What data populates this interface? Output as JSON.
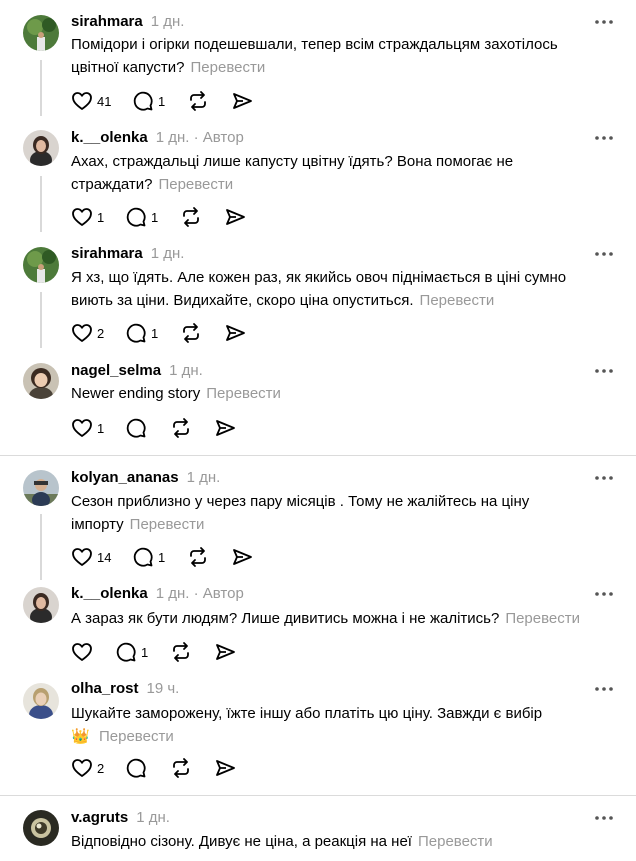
{
  "translate_label": "Перевести",
  "posts": [
    {
      "username": "sirahmara",
      "time": "1 дн.",
      "author": "",
      "text": "Помідори і огірки подешевшали, тепер всім страждальцям захотілось цвітної капусти?",
      "likes": "41",
      "replies": "1"
    },
    {
      "username": "k.__olenka",
      "time": "1 дн.",
      "author": "· Автор",
      "text": "Ахах, страждальці лише капусту цвітну їдять? Вона помогає не страждати?",
      "likes": "1",
      "replies": "1"
    },
    {
      "username": "sirahmara",
      "time": "1 дн.",
      "author": "",
      "text": "Я хз, що їдять. Але кожен раз, як якийсь овоч піднімається в ціні сумно виють за ціни. Видихайте, скоро ціна опуститься.",
      "likes": "2",
      "replies": "1"
    },
    {
      "username": "nagel_selma",
      "time": "1 дн.",
      "author": "",
      "text": "Newer ending story",
      "likes": "1",
      "replies": ""
    },
    {
      "username": "kolyan_ananas",
      "time": "1 дн.",
      "author": "",
      "text": "Сезон приблизно у через пару місяців . Тому не жалійтесь на ціну імпорту",
      "likes": "14",
      "replies": "1"
    },
    {
      "username": "k.__olenka",
      "time": "1 дн.",
      "author": "· Автор",
      "text": "А зараз як бути людям? Лише дивитись можна і не жалітись?",
      "likes": "",
      "replies": "1"
    },
    {
      "username": "olha_rost",
      "time": "19 ч.",
      "author": "",
      "text": "Шукайте заморожену, їжте іншу або платіть цю ціну. Завжди є вибір",
      "emoji": "👑",
      "likes": "2",
      "replies": ""
    },
    {
      "username": "v.agruts",
      "time": "1 дн.",
      "author": "",
      "text": "Відповідно сізону. Дивує не ціна, а реакція на неї",
      "likes": "",
      "replies": ""
    }
  ],
  "colors": {
    "muted": "#999999",
    "divider": "#dbdbdb",
    "thread": "#d9d9d9"
  },
  "icons": [
    "heart-icon",
    "comment-icon",
    "repost-icon",
    "share-icon",
    "more-icon"
  ]
}
